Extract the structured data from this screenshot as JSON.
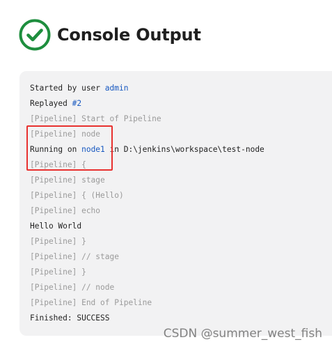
{
  "page": {
    "title": "Console Output",
    "status_icon": "success-check-icon",
    "status_color": "#1e8e3e"
  },
  "console": {
    "lines": {
      "l1_prefix": "Started by user ",
      "l1_link": "admin",
      "l2_prefix": "Replayed ",
      "l2_link": "#2",
      "l3": "[Pipeline] Start of Pipeline",
      "l4": "[Pipeline] node",
      "l5_prefix": "Running on ",
      "l5_link": "node1",
      "l5_suffix": " in D:\\jenkins\\workspace\\test-node",
      "l6": "[Pipeline] {",
      "l7": "[Pipeline] stage",
      "l8": "[Pipeline] { (Hello)",
      "l9": "[Pipeline] echo",
      "l10": "Hello World",
      "l11": "[Pipeline] }",
      "l12": "[Pipeline] // stage",
      "l13": "[Pipeline] }",
      "l14": "[Pipeline] // node",
      "l15": "[Pipeline] End of Pipeline",
      "l16": "Finished: SUCCESS"
    },
    "highlight_color": "#e8312f",
    "link_color": "#1758c0"
  },
  "watermark": "CSDN @summer_west_fish"
}
